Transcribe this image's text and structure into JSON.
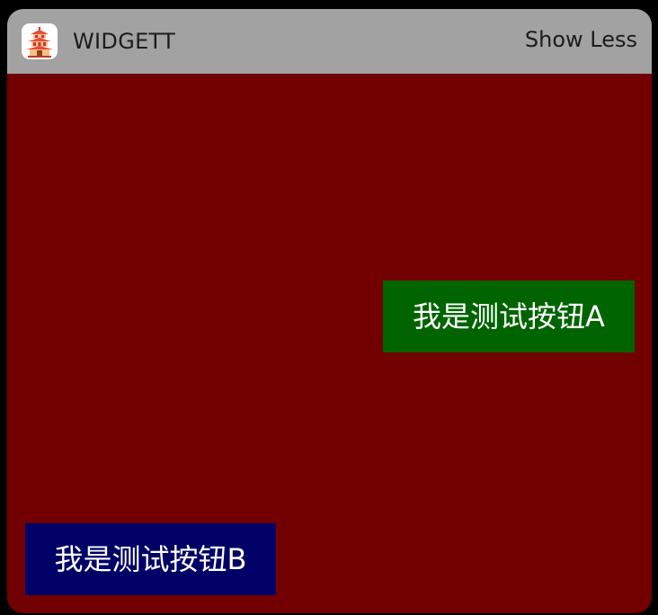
{
  "widget": {
    "app_name": "WIDGETT",
    "app_icon": "pagoda-icon",
    "toggle_label": "Show Less",
    "colors": {
      "header_bg": "#a2a2a2",
      "content_bg": "#720000",
      "button_a_bg": "#006400",
      "button_b_bg": "#000066"
    }
  },
  "content": {
    "button_a_label": "我是测试按钮A",
    "button_b_label": "我是测试按钮B"
  }
}
